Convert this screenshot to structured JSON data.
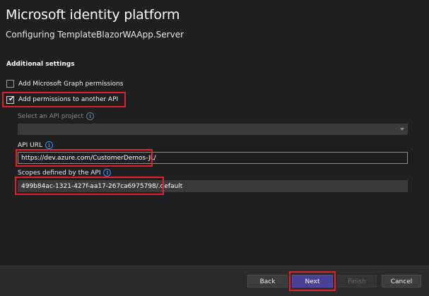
{
  "header": {
    "title": "Microsoft identity platform",
    "subtitle": "Configuring TemplateBlazorWAApp.Server"
  },
  "section": {
    "heading": "Additional settings"
  },
  "options": {
    "graph_permissions": {
      "label": "Add Microsoft Graph permissions",
      "checked": false
    },
    "another_api": {
      "label": "Add permissions to another API",
      "checked": true
    }
  },
  "api_project": {
    "label": "Select an API project",
    "selected": ""
  },
  "api_url": {
    "label": "API URL",
    "value": "https://dev.azure.com/CustomerDemos-JL/"
  },
  "scopes": {
    "label": "Scopes defined by the API",
    "value": "499b84ac-1321-427f-aa17-267ca6975798/.default"
  },
  "footer": {
    "back_label": "Back",
    "next_label": "Next",
    "finish_label": "Finish",
    "cancel_label": "Cancel"
  },
  "icons": {
    "info": "info-icon",
    "check": "check-icon",
    "dropdown": "chevron-down-icon"
  },
  "colors": {
    "background": "#1f1f1f",
    "primary_button": "#4a3f96",
    "highlight": "#e0202a",
    "info": "#3794ff"
  }
}
